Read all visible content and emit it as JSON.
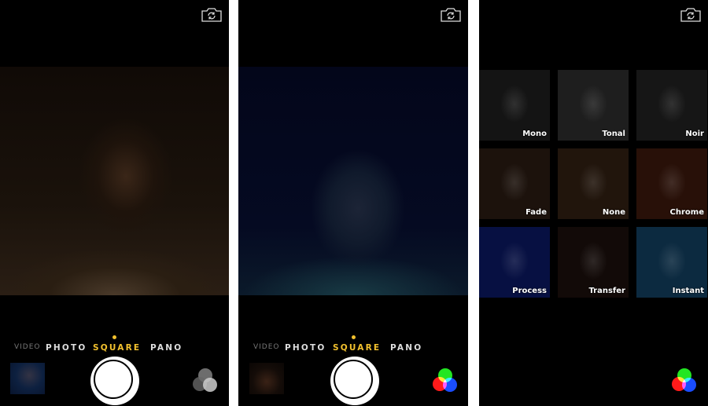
{
  "panels": [
    {
      "id": "camera-normal",
      "modes": [
        "VIDEO",
        "PHOTO",
        "SQUARE",
        "PANO"
      ],
      "selected_mode": "SQUARE",
      "filters_icon": "filters-icon-inactive",
      "flip_icon": "camera-flip-icon"
    },
    {
      "id": "camera-filter-applied",
      "modes": [
        "VIDEO",
        "PHOTO",
        "SQUARE",
        "PANO"
      ],
      "selected_mode": "SQUARE",
      "filters_icon": "filters-icon-active",
      "flip_icon": "camera-flip-icon"
    },
    {
      "id": "filter-picker",
      "flip_icon": "camera-flip-icon",
      "filters_icon": "filters-icon-active",
      "filters": [
        {
          "label": "Mono",
          "tint": "#141414"
        },
        {
          "label": "Tonal",
          "tint": "#1e1e1e"
        },
        {
          "label": "Noir",
          "tint": "#161616"
        },
        {
          "label": "Fade",
          "tint": "#1c120c"
        },
        {
          "label": "None",
          "tint": "#21150c"
        },
        {
          "label": "Chrome",
          "tint": "#281008"
        },
        {
          "label": "Process",
          "tint": "#071042"
        },
        {
          "label": "Transfer",
          "tint": "#120a08"
        },
        {
          "label": "Instant",
          "tint": "#0c2a40"
        }
      ]
    }
  ],
  "colors": {
    "accent": "#f2c12e",
    "background": "#000000",
    "divider": "#ffffff"
  }
}
